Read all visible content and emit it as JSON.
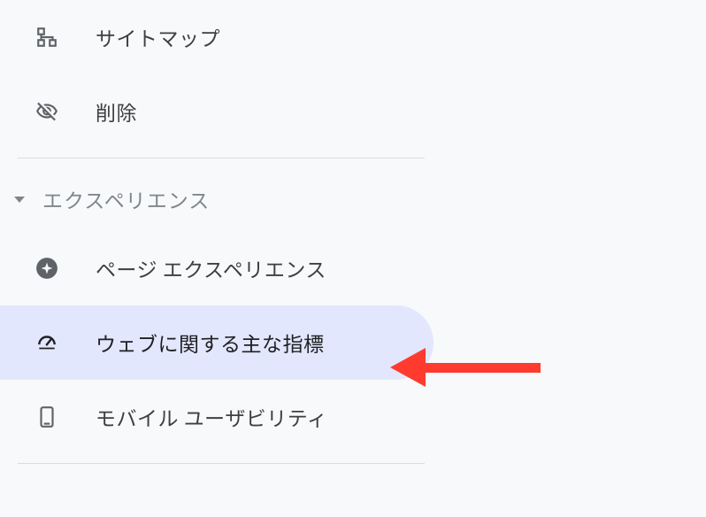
{
  "sidebar": {
    "items": [
      {
        "label": "サイトマップ",
        "icon": "sitemap"
      },
      {
        "label": "削除",
        "icon": "visibility-off"
      }
    ],
    "section": {
      "title": "エクスペリエンス",
      "items": [
        {
          "label": "ページ エクスペリエンス",
          "icon": "sparkle"
        },
        {
          "label": "ウェブに関する主な指標",
          "icon": "speed",
          "selected": true
        },
        {
          "label": "モバイル ユーザビリティ",
          "icon": "smartphone"
        }
      ]
    }
  },
  "annotation": {
    "type": "arrow",
    "color": "#ff3b30"
  }
}
